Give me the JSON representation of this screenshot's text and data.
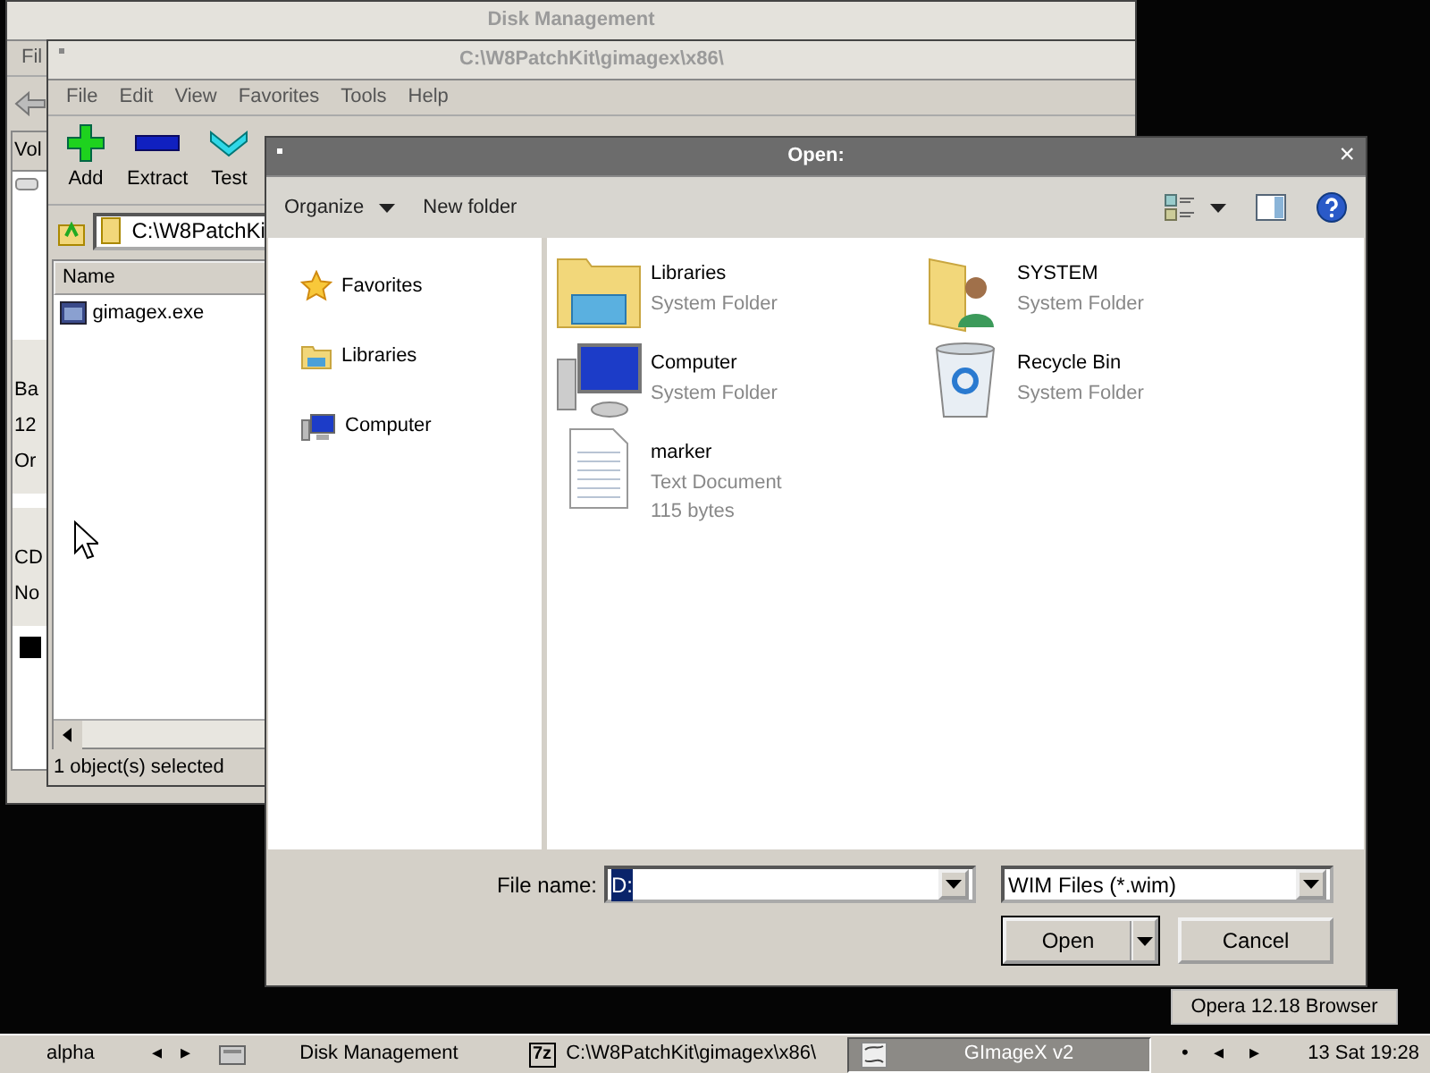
{
  "disk_management": {
    "title": "Disk Management",
    "menu": [
      "Fil"
    ],
    "column_header": "Vol",
    "disks": [
      {
        "lines": [
          "Ba",
          "12",
          "Or"
        ]
      },
      {
        "lines": [
          "CD",
          "No"
        ]
      }
    ]
  },
  "archiver": {
    "title": "C:\\W8PatchKit\\gimagex\\x86\\",
    "menu": [
      "File",
      "Edit",
      "View",
      "Favorites",
      "Tools",
      "Help"
    ],
    "toolbar": [
      {
        "label": "Add",
        "kind": "plus"
      },
      {
        "label": "Extract",
        "kind": "minus"
      },
      {
        "label": "Test",
        "kind": "check"
      }
    ],
    "address": "C:\\W8PatchKi",
    "columns": [
      "Name"
    ],
    "rows": [
      {
        "name": "gimagex.exe"
      }
    ],
    "status": "1 object(s) selected"
  },
  "open_dialog": {
    "title": "Open:",
    "close": "×",
    "toolbar": [
      {
        "label": "Organize",
        "dropdown": true
      },
      {
        "label": "New folder",
        "dropdown": false
      }
    ],
    "nav": [
      {
        "label": "Favorites",
        "kind": "star"
      },
      {
        "label": "Libraries",
        "kind": "library"
      },
      {
        "label": "Computer",
        "kind": "computer"
      }
    ],
    "items": [
      {
        "name": "Libraries",
        "type": "System Folder",
        "kind": "library"
      },
      {
        "name": "SYSTEM",
        "type": "System Folder",
        "kind": "user-folder"
      },
      {
        "name": "Computer",
        "type": "System Folder",
        "kind": "computer"
      },
      {
        "name": "Recycle Bin",
        "type": "System Folder",
        "kind": "recycle-bin"
      },
      {
        "name": "marker",
        "type": "Text Document",
        "size": "115 bytes",
        "kind": "document"
      }
    ],
    "file_name": {
      "label": "File name:",
      "value": "D:",
      "value_selected": true
    },
    "file_type": "WIM Files (*.wim)",
    "buttons": [
      {
        "label": "Open",
        "default": true,
        "split": true
      },
      {
        "label": "Cancel",
        "default": false,
        "split": false
      }
    ]
  },
  "tooltip": "Opera 12.18 Browser",
  "taskbar": {
    "workspace": "alpha",
    "pager": [
      "◂",
      "▸"
    ],
    "buttons": [
      {
        "label": "Disk Management",
        "kind": "drive",
        "selected": false
      },
      {
        "label": "C:\\W8PatchKit\\gimagex\\x86\\",
        "kind": "archive",
        "icon_text": "7z",
        "selected": false
      },
      {
        "label": "GImageX v2",
        "kind": "gimagex",
        "selected": true
      }
    ],
    "tray": [
      "•",
      "◂",
      "▸"
    ],
    "clock": "13 Sat 19:28"
  }
}
